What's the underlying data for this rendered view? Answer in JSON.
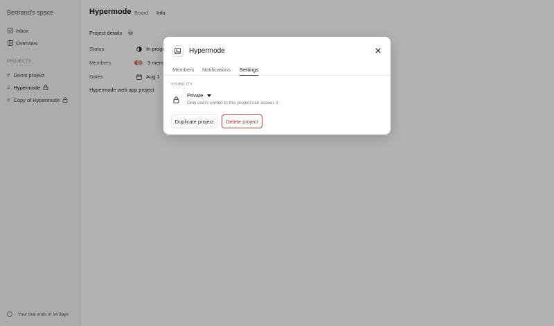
{
  "sidebar": {
    "space_name": "Bertrand's space",
    "nav": [
      {
        "label": "Inbox",
        "icon": "inbox-check-icon"
      },
      {
        "label": "Overview",
        "icon": "overview-icon"
      }
    ],
    "projects_label": "PROJECTS",
    "projects": [
      {
        "label": "Demo project",
        "locked": false
      },
      {
        "label": "Hypermode",
        "locked": true
      },
      {
        "label": "Copy of Hypermode",
        "locked": true
      }
    ],
    "trial_text": "Your trial ends in 14 days"
  },
  "header": {
    "title": "Hypermode",
    "tabs": [
      "Board",
      "Info"
    ],
    "active_tab": "Info"
  },
  "details": {
    "title": "Project details",
    "rows": [
      {
        "label": "Status",
        "value": "In progr"
      },
      {
        "label": "Members",
        "value": "3 mem"
      },
      {
        "label": "Dates",
        "value": "Aug 1"
      }
    ],
    "description": "Hypermode web app project"
  },
  "modal": {
    "title": "Hypermode",
    "tabs": [
      "Members",
      "Notifications",
      "Settings"
    ],
    "active_tab": "Settings",
    "visibility_label": "VISIBILITY",
    "visibility_value": "Private",
    "visibility_help": "Only users invited to this project can access it",
    "duplicate_label": "Duplicate project",
    "delete_label": "Delete project"
  },
  "colors": {
    "danger": "#aa3333",
    "overlay": "rgba(0,0,0,0.30)",
    "avatar_1": "#e2674a",
    "avatar_2": "#c9a6a0"
  }
}
